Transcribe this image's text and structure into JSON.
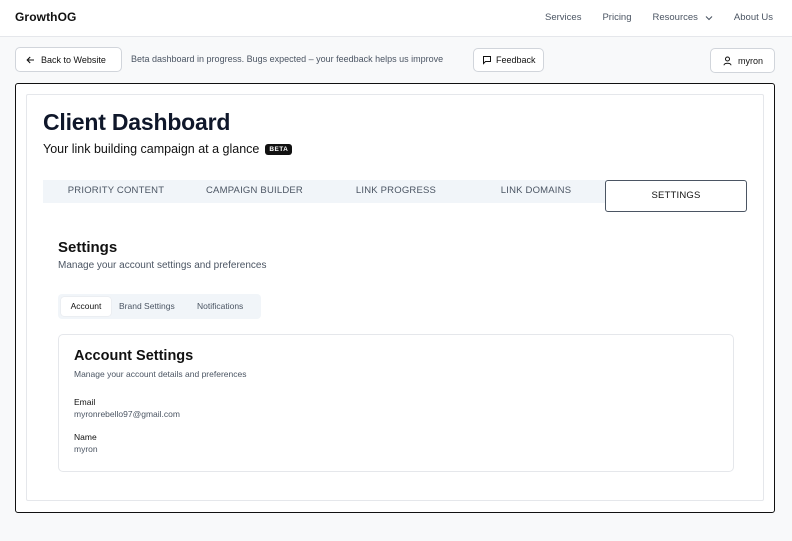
{
  "nav": {
    "brand": "GrowthOG",
    "links": [
      "Services",
      "Pricing",
      "Resources",
      "About Us"
    ]
  },
  "toolbar": {
    "back_label": "Back to Website",
    "beta_note": "Beta dashboard in progress. Bugs expected – your feedback helps us improve",
    "feedback_label": "Feedback",
    "user_label": "myron"
  },
  "dashboard": {
    "title": "Client Dashboard",
    "subtitle": "Your link building campaign at a glance",
    "badge": "BETA",
    "tabs": [
      "PRIORITY CONTENT",
      "CAMPAIGN BUILDER",
      "LINK PROGRESS",
      "LINK DOMAINS",
      "SETTINGS"
    ],
    "active_tab": "SETTINGS"
  },
  "settings": {
    "title": "Settings",
    "subtitle": "Manage your account settings and preferences",
    "subtabs": [
      "Account",
      "Brand Settings",
      "Notifications"
    ],
    "active_subtab": "Account"
  },
  "account": {
    "title": "Account Settings",
    "subtitle": "Manage your account details and preferences",
    "email_label": "Email",
    "email_value": "myronrebello97@gmail.com",
    "name_label": "Name",
    "name_value": "myron"
  },
  "icons": [
    "arrow-left-icon",
    "message-square-icon",
    "user-icon",
    "chevron-down-icon"
  ]
}
